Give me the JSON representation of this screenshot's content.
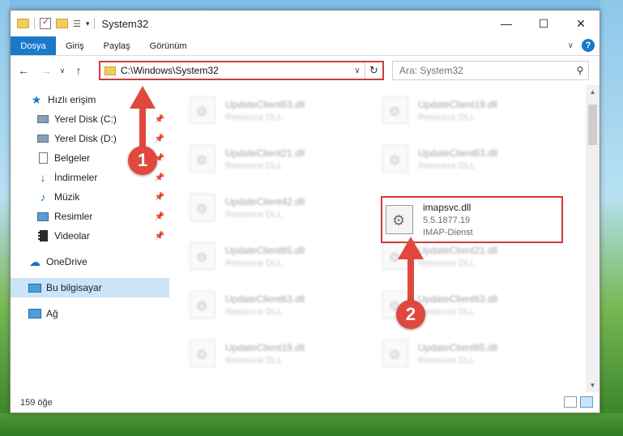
{
  "window": {
    "title": "System32"
  },
  "ribbon": {
    "tabs": [
      {
        "label": "Dosya"
      },
      {
        "label": "Giriş"
      },
      {
        "label": "Paylaş"
      },
      {
        "label": "Görünüm"
      }
    ]
  },
  "nav": {
    "address": "C:\\Windows\\System32",
    "search_placeholder": "Ara: System32"
  },
  "sidebar": {
    "items": [
      {
        "label": "Hızlı erişim",
        "icon": "star-icon"
      },
      {
        "label": "Yerel Disk (C:)",
        "icon": "disk-icon"
      },
      {
        "label": "Yerel Disk (D:)",
        "icon": "disk-icon"
      },
      {
        "label": "Belgeler",
        "icon": "document-icon"
      },
      {
        "label": "İndirmeler",
        "icon": "download-icon"
      },
      {
        "label": "Müzik",
        "icon": "music-icon"
      },
      {
        "label": "Resimler",
        "icon": "pictures-icon"
      },
      {
        "label": "Videolar",
        "icon": "video-icon"
      },
      {
        "label": "OneDrive",
        "icon": "cloud-icon"
      },
      {
        "label": "Bu bilgisayar",
        "icon": "computer-icon"
      },
      {
        "label": "Ağ",
        "icon": "network-icon"
      }
    ]
  },
  "files": [
    {
      "name": "UpdateClient63.dll",
      "desc": "Resource DLL"
    },
    {
      "name": "UpdateClient19.dll",
      "desc": "Resource DLL"
    },
    {
      "name": "UpdateClient21.dll",
      "desc": "Resource DLL"
    },
    {
      "name": "UpdateClient63.dll",
      "desc": "Resource DLL"
    },
    {
      "name": "UpdateClient42.dll",
      "desc": "Resource DLL"
    },
    {
      "name": "UpdateClient65.dll",
      "desc": "Resource DLL"
    },
    {
      "name": "UpdateClient21.dll",
      "desc": "Resource DLL"
    },
    {
      "name": "UpdateClient63.dll",
      "desc": "Resource DLL"
    },
    {
      "name": "UpdateClient63.dll",
      "desc": "Resource DLL"
    },
    {
      "name": "UpdateClient19.dll",
      "desc": "Resource DLL"
    },
    {
      "name": "UpdateClient65.dll",
      "desc": "Resource DLL"
    }
  ],
  "target_file": {
    "name": "imapsvc.dll",
    "version": "5.5.1877.19",
    "desc": "IMAP-Dienst"
  },
  "status": {
    "count": "159 öğe"
  },
  "annotations": {
    "badge1": "1",
    "badge2": "2",
    "color": "#e0483f"
  }
}
